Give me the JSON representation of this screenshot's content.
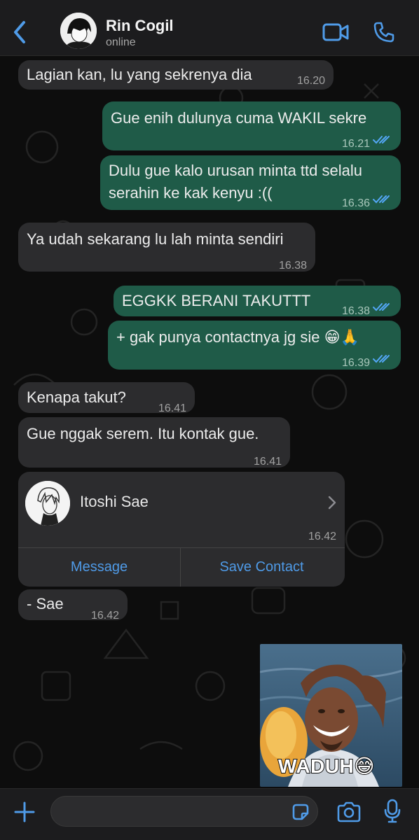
{
  "header": {
    "name": "Rin Cogil",
    "status": "online",
    "icons": [
      "chevron-left-icon",
      "video-camera-icon",
      "phone-icon"
    ]
  },
  "messages": [
    {
      "dir": "in",
      "text": "Lagian kan, lu yang sekrenya dia",
      "time": "16.20"
    },
    {
      "dir": "out",
      "text": "Gue enih dulunya cuma WAKIL sekre",
      "time": "16.21",
      "read": true
    },
    {
      "dir": "out",
      "lines": [
        "Dulu gue kalo urusan minta ttd selalu",
        "serahin ke kak kenyu :(("
      ],
      "time": "16.36",
      "read": true
    },
    {
      "dir": "in",
      "text": "Ya udah sekarang lu lah minta sendiri",
      "time": "16.38"
    },
    {
      "dir": "out",
      "text": "EGGKK BERANI TAKUTTT",
      "time": "16.38",
      "read": true
    },
    {
      "dir": "out",
      "text": "+ gak punya contactnya jg sie 😁🙏",
      "time": "16.39",
      "read": true
    },
    {
      "dir": "in",
      "text": "Kenapa takut?",
      "time": "16.41"
    },
    {
      "dir": "in",
      "text": "Gue nggak serem. Itu kontak gue.",
      "time": "16.41"
    },
    {
      "dir": "in",
      "text": "- Sae",
      "time": "16.42"
    }
  ],
  "contact_card": {
    "name": "Itoshi Sae",
    "time": "16.42",
    "message_label": "Message",
    "save_label": "Save Contact"
  },
  "sticker": {
    "caption": "WADUH😅"
  },
  "composer": {
    "value": "",
    "icons": [
      "plus-icon",
      "sticker-icon",
      "camera-icon",
      "microphone-icon"
    ]
  },
  "colors": {
    "accent": "#4f9be8",
    "outgoing_bubble": "#1f5b48",
    "incoming_bubble": "#2c2c2e",
    "read_ticks": "#53a6f5"
  }
}
